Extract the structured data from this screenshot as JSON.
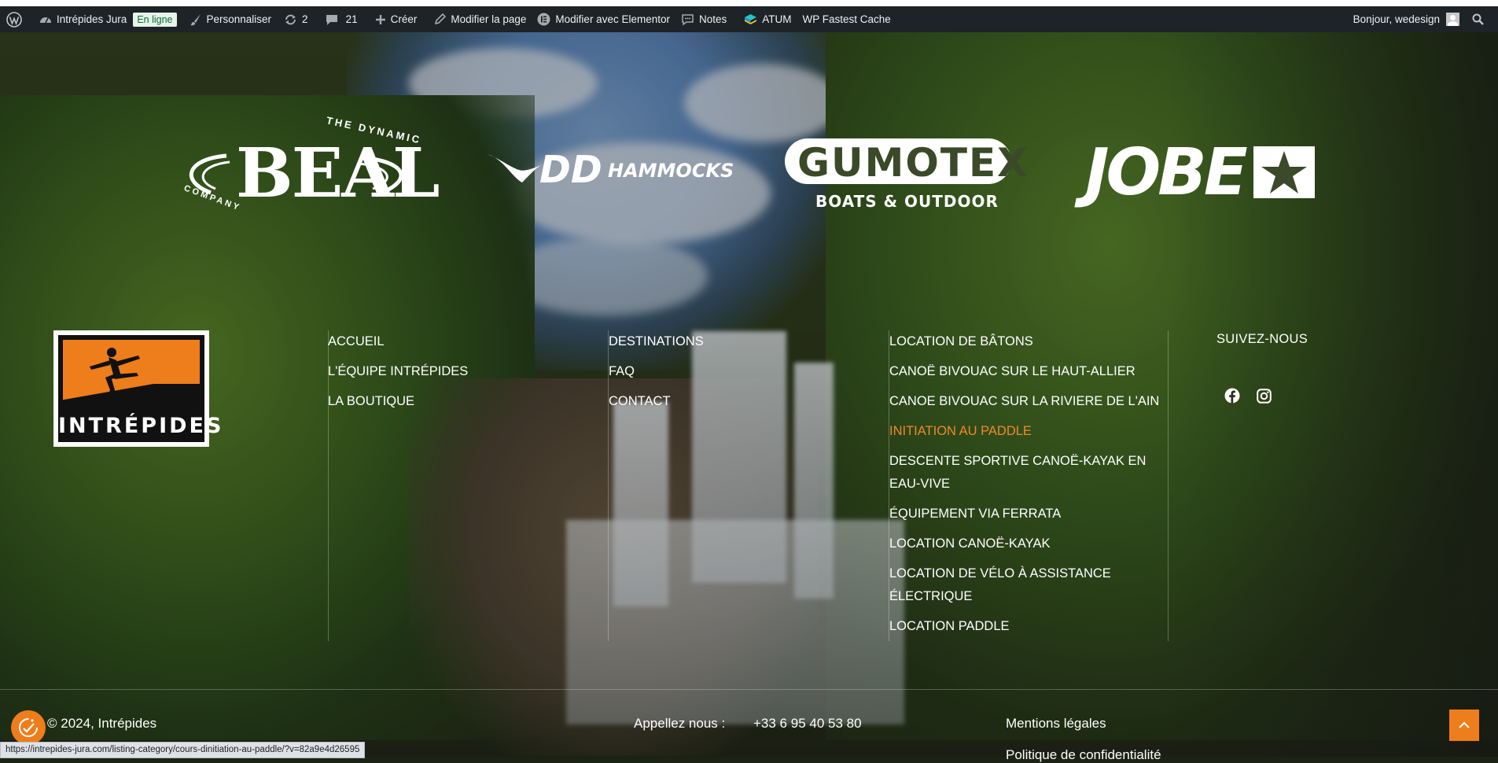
{
  "adminbar": {
    "site_name": "Intrépides Jura",
    "status_badge": "En ligne",
    "customize": "Personnaliser",
    "updates_count": "2",
    "comments_count": "21",
    "create": "Créer",
    "edit_page": "Modifier la page",
    "edit_elementor": "Modifier avec Elementor",
    "notes": "Notes",
    "atum": "ATUM",
    "cache": "WP Fastest Cache",
    "greeting": "Bonjour, wedesign"
  },
  "partners": {
    "beal": {
      "main": "BEAL",
      "top": "THE DYNAMIC",
      "bottom": "COMPANY"
    },
    "dd": {
      "main": "DD",
      "sub": "HAMMOCKS"
    },
    "gumotex": {
      "main": "GUMOTEX",
      "sub": "BOATS & OUTDOOR"
    },
    "jobe": {
      "main": "JOBE"
    }
  },
  "brand": {
    "name": "INTRÉPIDES"
  },
  "menu1": [
    "ACCUEIL",
    "L'ÉQUIPE INTRÉPIDES",
    "LA BOUTIQUE"
  ],
  "menu2": [
    "DESTINATIONS",
    "FAQ",
    "CONTACT"
  ],
  "menu3": [
    "LOCATION DE BÂTONS",
    "CANOË BIVOUAC SUR LE HAUT-ALLIER",
    "CANOE BIVOUAC SUR LA RIVIERE DE L'AIN",
    "INITIATION AU PADDLE",
    "DESCENTE SPORTIVE CANOË-KAYAK EN EAU-VIVE",
    "ÉQUIPEMENT VIA FERRATA",
    "LOCATION CANOË-KAYAK",
    "LOCATION DE VÉLO À ASSISTANCE ÉLECTRIQUE",
    "LOCATION PADDLE"
  ],
  "menu3_active_index": 3,
  "follow": {
    "title": "SUIVEZ-NOUS"
  },
  "footer": {
    "copyright": "© 2024, Intrépides",
    "phone_label": "Appellez nous :",
    "phone": "+33 6 95 40 53 80",
    "legal": "Mentions légales",
    "privacy": "Politique de confidentialité"
  },
  "status_url": "https://intrepides-jura.com/listing-category/cours-dinitiation-au-paddle/?v=82a9e4d26595",
  "colors": {
    "accent": "#ee7d1c",
    "active_link": "#f08a24",
    "adminbar": "#1d2327"
  }
}
